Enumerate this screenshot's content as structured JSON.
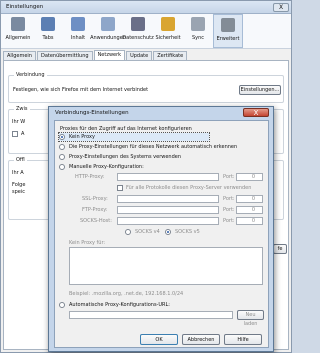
{
  "window": {
    "title": "Einstellungen",
    "close": "X"
  },
  "toolbar": {
    "items": [
      {
        "label": "Allgemein",
        "icon": "general-icon",
        "color": "#7a8aa0"
      },
      {
        "label": "Tabs",
        "icon": "tabs-icon",
        "color": "#5c7fb3"
      },
      {
        "label": "Inhalt",
        "icon": "content-icon",
        "color": "#6e8fc4"
      },
      {
        "label": "Anwendungen",
        "icon": "applications-icon",
        "color": "#8ea6c9"
      },
      {
        "label": "Datenschutz",
        "icon": "privacy-icon",
        "color": "#6a6f88"
      },
      {
        "label": "Sicherheit",
        "icon": "security-lock-icon",
        "color": "#d9a531"
      },
      {
        "label": "Sync",
        "icon": "sync-icon",
        "color": "#9aa4b1"
      },
      {
        "label": "Erweitert",
        "icon": "advanced-gear-icon",
        "color": "#838c96"
      }
    ]
  },
  "subtabs": [
    "Allgemein",
    "Datenübermittlung",
    "Netzwerk",
    "Update",
    "Zertifikate"
  ],
  "connection": {
    "heading": "Verbindung",
    "text": "Festlegen, wie sich Firefox mit dem Internet verbindet",
    "button": "Einstellungen..."
  },
  "bg_fragments": {
    "zone": "Zwis",
    "ihr": "Ihr W",
    "a": "A",
    "offline": "Offl",
    "ihr2": "Ihr A",
    "folge": "Folge",
    "speic": "speic",
    "ke": "fe"
  },
  "dialog": {
    "title": "Verbindungs-Einstellungen",
    "close": "X",
    "group": "Proxies für den Zugriff auf das Internet konfigurieren",
    "opt_none": "Kein Proxy",
    "opt_detect": "Die Proxy-Einstellungen für dieses Netzwerk automatisch erkennen",
    "opt_system": "Proxy-Einstellungen des Systems verwenden",
    "opt_manual": "Manuelle Proxy-Konfiguration:",
    "http_label": "HTTP-Proxy:",
    "port_label": "Port:",
    "port_value": "0",
    "all_protocols": "Für alle Protokolle diesen Proxy-Server verwenden",
    "ssl_label": "SSL-Proxy:",
    "ftp_label": "FTP-Proxy:",
    "socks_label": "SOCKS-Host:",
    "socks4": "SOCKS v4",
    "socks5": "SOCKS v5",
    "noproxy_label": "Kein Proxy für:",
    "example": "Beispiel: .mozilla.org, .net.de, 192.168.1.0/24",
    "opt_auto": "Automatische Proxy-Konfigurations-URL:",
    "reload": "Neu laden",
    "ok": "OK",
    "cancel": "Abbrechen",
    "help": "Hilfe"
  }
}
